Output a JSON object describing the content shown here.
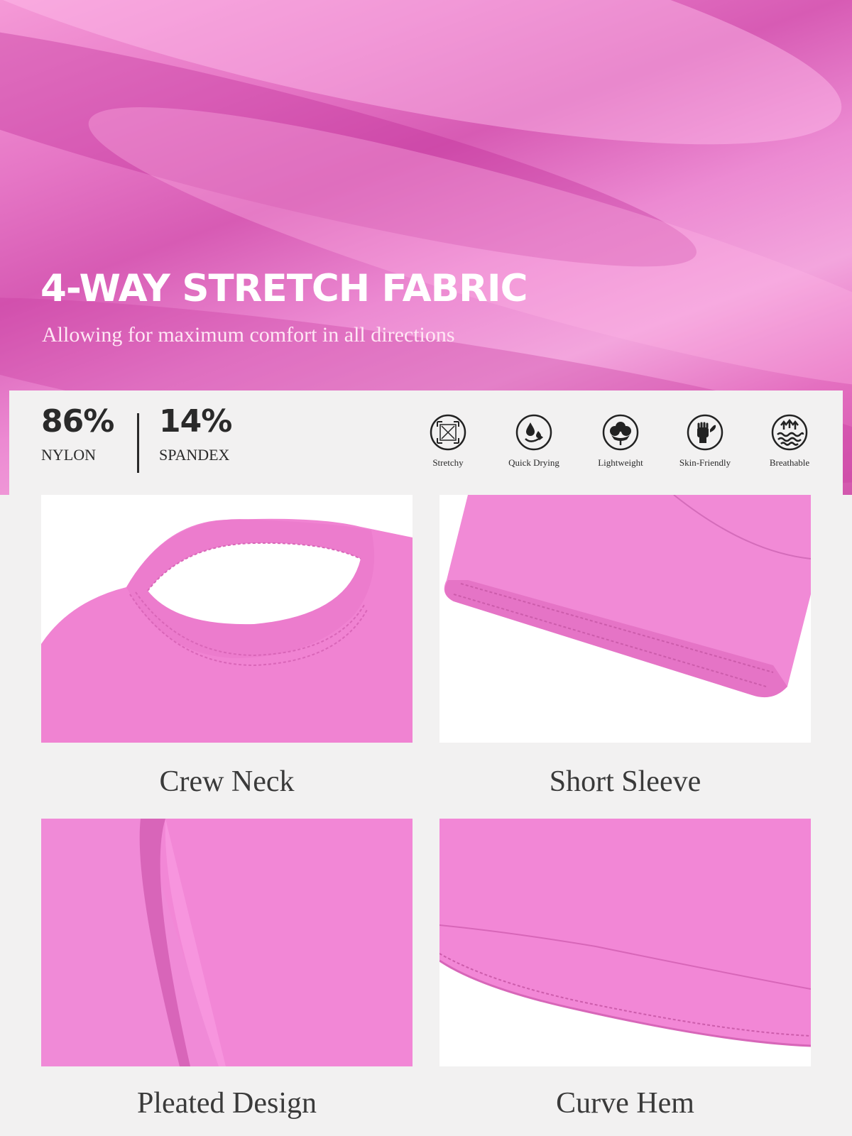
{
  "hero": {
    "title": "4-WAY STRETCH FABRIC",
    "subtitle": "Allowing for maximum comfort in all directions"
  },
  "composition": [
    {
      "percent": "86%",
      "material": "NYLON"
    },
    {
      "percent": "14%",
      "material": "SPANDEX"
    }
  ],
  "features": [
    {
      "label": "Stretchy",
      "icon": "stretch-arrows-icon"
    },
    {
      "label": "Quick Drying",
      "icon": "water-drops-icon"
    },
    {
      "label": "Lightweight",
      "icon": "cotton-flower-icon"
    },
    {
      "label": "Skin-Friendly",
      "icon": "hand-leaf-icon"
    },
    {
      "label": "Breathable",
      "icon": "air-waves-icon"
    }
  ],
  "details": [
    {
      "caption": "Crew Neck"
    },
    {
      "caption": "Short Sleeve"
    },
    {
      "caption": "Pleated Design"
    },
    {
      "caption": "Curve Hem"
    }
  ],
  "colors": {
    "fabric_pink": "#f28ad6",
    "text_dark": "#2a2a2a",
    "panel_bg": "#f2f1f1"
  }
}
